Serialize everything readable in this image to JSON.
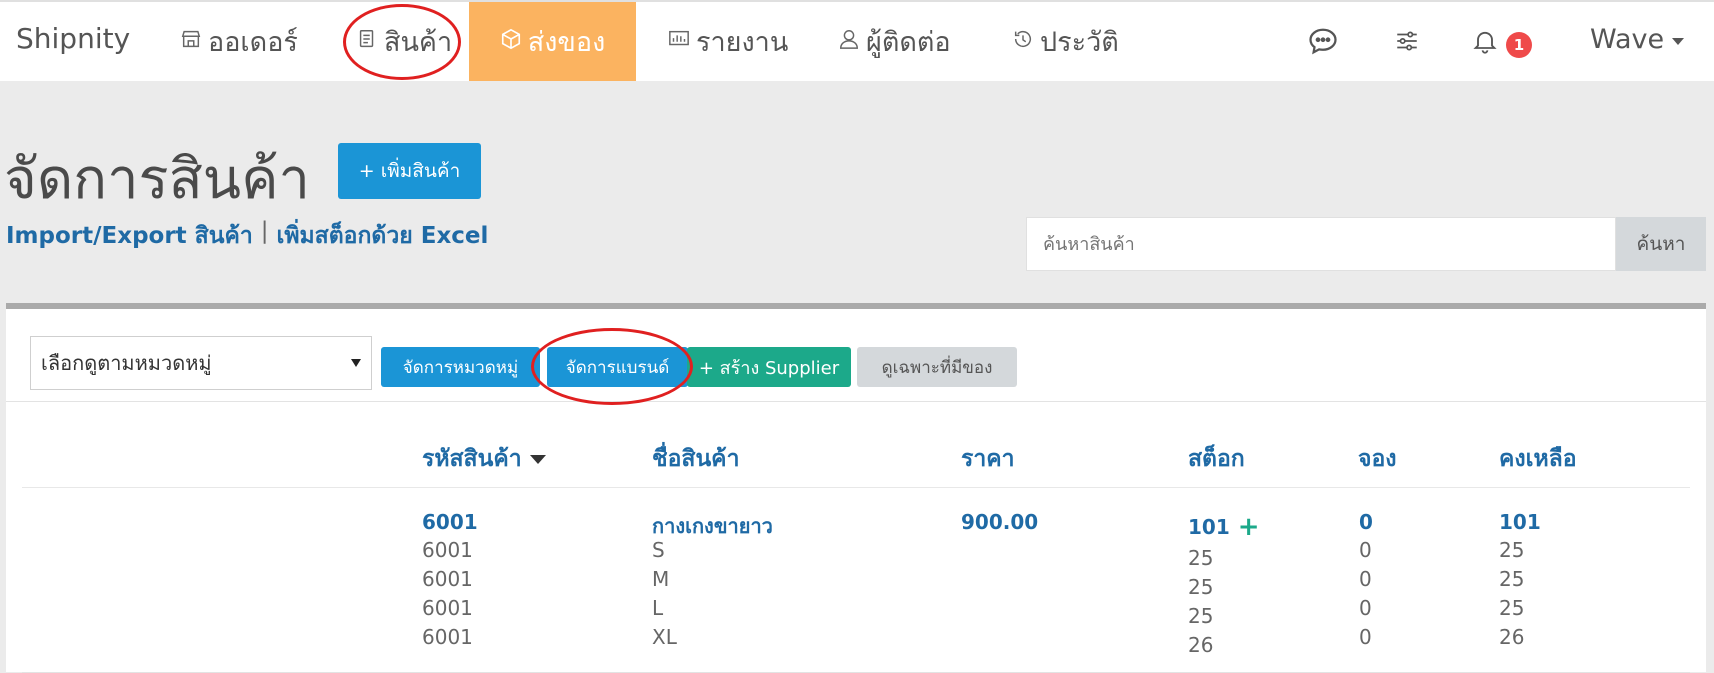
{
  "nav": {
    "brand": "Shipnity",
    "items": [
      {
        "label": "ออเดอร์",
        "icon": "store-icon"
      },
      {
        "label": "สินค้า",
        "icon": "document-icon"
      },
      {
        "label": "ส่งของ",
        "icon": "box-icon"
      },
      {
        "label": "รายงาน",
        "icon": "report-icon"
      },
      {
        "label": "ผู้ติดต่อ",
        "icon": "user-icon"
      },
      {
        "label": "ประวัติ",
        "icon": "history-icon"
      }
    ],
    "right_icons": [
      "chat-icon",
      "sliders-icon",
      "bell-icon"
    ],
    "notification_count": "1",
    "user": "Wave"
  },
  "page": {
    "title": "จัดการสินค้า",
    "add_button": "+ เพิ่มสินค้า",
    "link_import": "Import/Export สินค้า",
    "link_sep": "|",
    "link_stock": "เพิ่มสต็อกด้วย Excel",
    "search_placeholder": "ค้นหาสินค้า",
    "search_button": "ค้นหา"
  },
  "toolbar": {
    "category_select": "เลือกดูตามหมวดหมู่",
    "manage_category": "จัดการหมวดหมู่",
    "manage_brand": "จัดการแบรนด์",
    "create_supplier": "+ สร้าง Supplier",
    "in_stock_only": "ดูเฉพาะที่มีของ"
  },
  "table": {
    "headers": {
      "sku": "รหัสสินค้า",
      "name": "ชื่อสินค้า",
      "price": "ราคา",
      "stock": "สต็อก",
      "reserved": "จอง",
      "remaining": "คงเหลือ"
    },
    "product": {
      "sku": "6001",
      "name": "กางเกงขายาว",
      "price": "900.00",
      "stock": "101",
      "stock_plus": "+",
      "reserved": "0",
      "remaining": "101"
    },
    "variants": [
      {
        "sku": "6001",
        "name": "S",
        "stock": "25",
        "reserved": "0",
        "remaining": "25"
      },
      {
        "sku": "6001",
        "name": "M",
        "stock": "25",
        "reserved": "0",
        "remaining": "25"
      },
      {
        "sku": "6001",
        "name": "L",
        "stock": "25",
        "reserved": "0",
        "remaining": "25"
      },
      {
        "sku": "6001",
        "name": "XL",
        "stock": "26",
        "reserved": "0",
        "remaining": "26"
      }
    ]
  },
  "colors": {
    "active_tab": "#fbb360",
    "primary_blue": "#1b95d6",
    "green": "#1ca98a",
    "link_blue": "#1f6aa5",
    "highlight_red": "#e02020"
  }
}
